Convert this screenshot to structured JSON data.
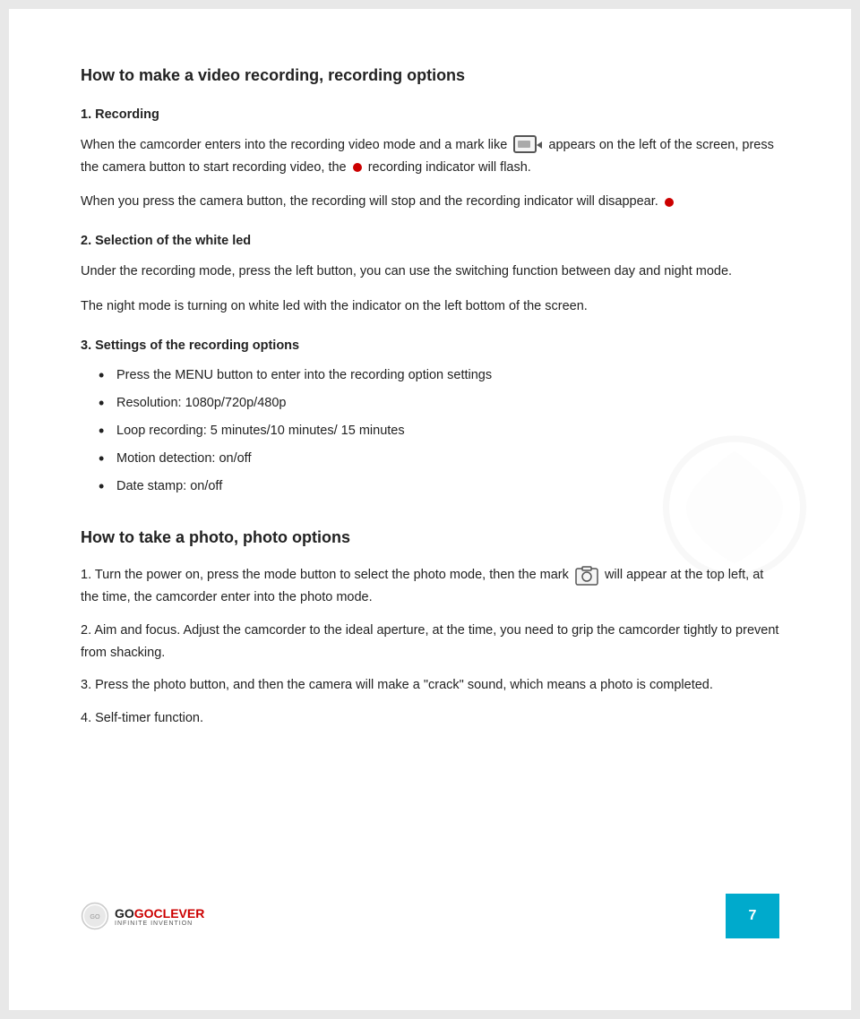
{
  "page": {
    "main_heading": "How to make a video recording, recording options",
    "section1": {
      "number": "1. Recording",
      "para1_before": "When the camcorder enters into the recording video mode and a mark like",
      "para1_after": "appears on the left of the screen, press the camera button to start recording video, the",
      "para1_end": "recording indicator will flash.",
      "para2": "When you press the camera button, the recording will stop and the recording indicator will disappear."
    },
    "section2": {
      "number": "2. Selection of the white led",
      "para1": "Under the recording mode, press the left button, you can use the switching function between day and night mode.",
      "para2": "The night mode is turning on white led with the indicator on the left bottom of the screen."
    },
    "section3": {
      "number": "3. Settings of the recording options",
      "bullets": [
        "Press the MENU button to enter into the recording option settings",
        "Resolution: 1080p/720p/480p",
        "Loop recording: 5 minutes/10 minutes/ 15 minutes",
        "Motion detection: on/off",
        "Date stamp: on/off"
      ]
    },
    "photo_section": {
      "heading": "How to take a photo, photo options",
      "items": [
        {
          "number": "1.",
          "text_before": "Turn the power on, press the mode button to select the photo mode, then the mark",
          "text_after": "will appear at the top left, at the time, the camcorder enter into the photo mode."
        },
        {
          "number": "2.",
          "text": "Aim and focus. Adjust the camcorder to the ideal aperture, at the time, you need to grip the camcorder tightly to prevent from shacking."
        },
        {
          "number": "3.",
          "text": "Press the photo button, and then the camera will make a \"crack\" sound, which means a photo is completed."
        },
        {
          "number": "4.",
          "text": "Self-timer function."
        }
      ]
    },
    "footer": {
      "logo_go": "GO",
      "logo_brand": "GOCLEVER",
      "logo_subtitle": "INFINITE INVENTION",
      "page_number": "7"
    }
  }
}
